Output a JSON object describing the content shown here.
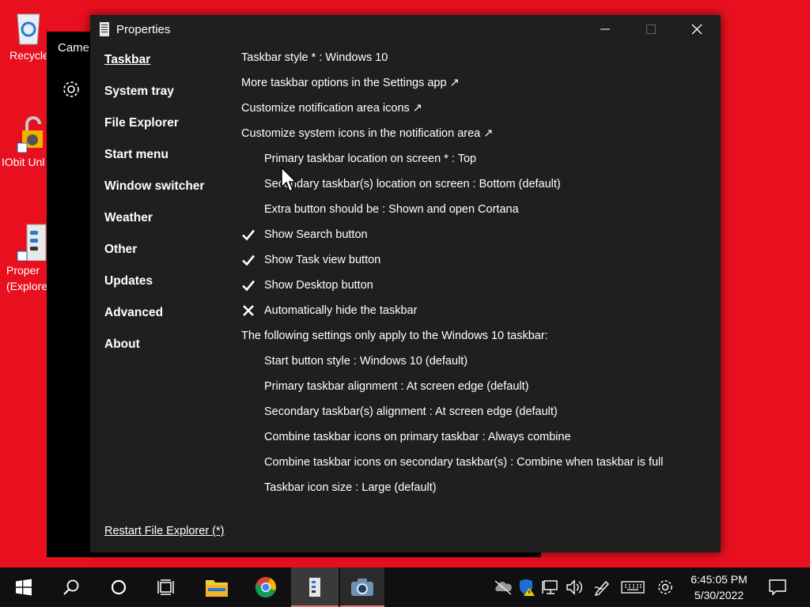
{
  "desktop": {
    "icons": [
      {
        "label": "Recycle"
      },
      {
        "label": "IObit Unl"
      },
      {
        "label": "Proper\n(Explore"
      }
    ]
  },
  "camera_window": {
    "title": "Camer"
  },
  "window": {
    "title": "Properties",
    "controls": {
      "minimize": "minimize",
      "maximize": "maximize",
      "close": "close"
    }
  },
  "nav": {
    "items": [
      {
        "label": "Taskbar",
        "active": true
      },
      {
        "label": "System tray"
      },
      {
        "label": "File Explorer"
      },
      {
        "label": "Start menu"
      },
      {
        "label": "Window switcher"
      },
      {
        "label": "Weather"
      },
      {
        "label": "Other"
      },
      {
        "label": "Updates"
      },
      {
        "label": "Advanced"
      },
      {
        "label": "About"
      }
    ]
  },
  "settings": [
    {
      "text": "Taskbar style * : Windows 10",
      "indent": false,
      "mark": ""
    },
    {
      "text": "More taskbar options in the Settings app ↗",
      "indent": false,
      "mark": ""
    },
    {
      "text": "Customize notification area icons ↗",
      "indent": false,
      "mark": ""
    },
    {
      "text": "Customize system icons in the notification area ↗",
      "indent": false,
      "mark": ""
    },
    {
      "text": "Primary taskbar location on screen * : Top",
      "indent": true,
      "mark": ""
    },
    {
      "text": "Secondary taskbar(s) location on screen : Bottom (default)",
      "indent": true,
      "mark": ""
    },
    {
      "text": "Extra button should be : Shown and open Cortana",
      "indent": true,
      "mark": ""
    },
    {
      "text": "Show Search button",
      "indent": true,
      "mark": "check"
    },
    {
      "text": "Show Task view button",
      "indent": true,
      "mark": "check"
    },
    {
      "text": "Show Desktop button",
      "indent": true,
      "mark": "check"
    },
    {
      "text": "Automatically hide the taskbar",
      "indent": true,
      "mark": "cross"
    },
    {
      "text": "The following settings only apply to the Windows 10 taskbar:",
      "indent": false,
      "mark": "",
      "static": true
    },
    {
      "text": "Start button style : Windows 10 (default)",
      "indent": true,
      "mark": ""
    },
    {
      "text": "Primary taskbar alignment : At screen edge (default)",
      "indent": true,
      "mark": ""
    },
    {
      "text": "Secondary taskbar(s) alignment : At screen edge (default)",
      "indent": true,
      "mark": ""
    },
    {
      "text": "Combine taskbar icons on primary taskbar : Always combine",
      "indent": true,
      "mark": ""
    },
    {
      "text": "Combine taskbar icons on secondary taskbar(s) : Combine when taskbar is full",
      "indent": true,
      "mark": ""
    },
    {
      "text": "Taskbar icon size : Large (default)",
      "indent": true,
      "mark": ""
    }
  ],
  "footer": {
    "restart_label": "Restart File Explorer (*)"
  },
  "taskbar": {
    "buttons": [
      {
        "icon": "start-icon"
      },
      {
        "icon": "search-icon"
      },
      {
        "icon": "cortana-icon"
      },
      {
        "icon": "task-view-icon"
      },
      {
        "icon": "file-explorer-icon"
      },
      {
        "icon": "chrome-icon"
      },
      {
        "icon": "properties-app-icon",
        "active": true
      },
      {
        "icon": "camera-app-icon",
        "active": true
      }
    ],
    "tray_icons": [
      "onedrive-icon",
      "security-icon",
      "network-icon",
      "volume-icon",
      "pen-icon",
      "keyboard-icon",
      "settings-icon"
    ],
    "time": "6:45:05 PM",
    "date": "5/30/2022"
  }
}
